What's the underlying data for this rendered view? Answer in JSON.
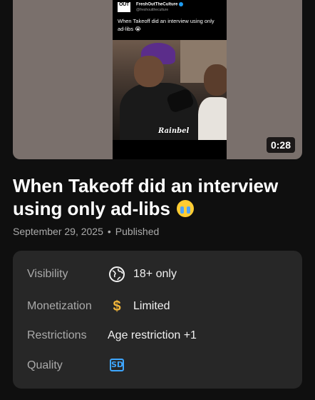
{
  "video": {
    "thumbnail": {
      "source_logo_text": "OUT",
      "account_name": "FreshOutTheCulture",
      "account_handle": "@freshouttheculture",
      "post_text": "When Takeoff did an interview using only ad-libs 😭",
      "watermark": "Rainbel",
      "duration": "0:28"
    },
    "title": "When Takeoff did an interview using only ad-libs",
    "date": "September 29, 2025",
    "separator": "•",
    "status": "Published"
  },
  "details": {
    "rows": [
      {
        "label": "Visibility",
        "icon": "globe-icon",
        "value": "18+ only"
      },
      {
        "label": "Monetization",
        "icon": "dollar-icon",
        "value": "Limited",
        "icon_color": "#f0b53a"
      },
      {
        "label": "Restrictions",
        "value": "Age restriction +1"
      },
      {
        "label": "Quality",
        "icon": "sd-badge-icon",
        "badge_text": "SD",
        "icon_color": "#3ea6ff"
      }
    ]
  }
}
